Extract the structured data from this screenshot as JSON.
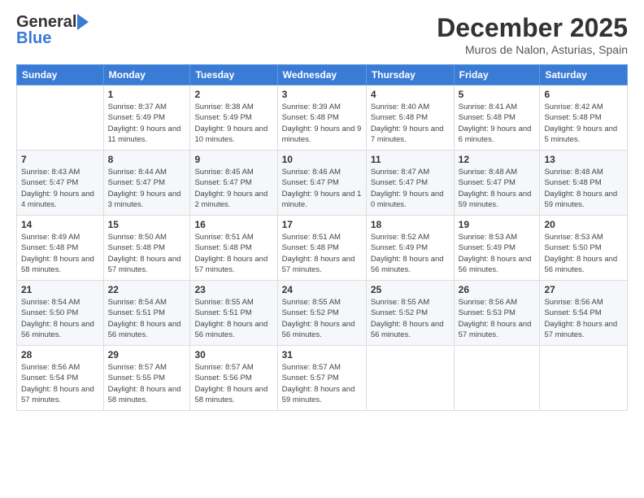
{
  "header": {
    "logo_general": "General",
    "logo_blue": "Blue",
    "title": "December 2025",
    "location": "Muros de Nalon, Asturias, Spain"
  },
  "days_of_week": [
    "Sunday",
    "Monday",
    "Tuesday",
    "Wednesday",
    "Thursday",
    "Friday",
    "Saturday"
  ],
  "weeks": [
    [
      {
        "day": "",
        "sunrise": "",
        "sunset": "",
        "daylight": ""
      },
      {
        "day": "1",
        "sunrise": "Sunrise: 8:37 AM",
        "sunset": "Sunset: 5:49 PM",
        "daylight": "Daylight: 9 hours and 11 minutes."
      },
      {
        "day": "2",
        "sunrise": "Sunrise: 8:38 AM",
        "sunset": "Sunset: 5:49 PM",
        "daylight": "Daylight: 9 hours and 10 minutes."
      },
      {
        "day": "3",
        "sunrise": "Sunrise: 8:39 AM",
        "sunset": "Sunset: 5:48 PM",
        "daylight": "Daylight: 9 hours and 9 minutes."
      },
      {
        "day": "4",
        "sunrise": "Sunrise: 8:40 AM",
        "sunset": "Sunset: 5:48 PM",
        "daylight": "Daylight: 9 hours and 7 minutes."
      },
      {
        "day": "5",
        "sunrise": "Sunrise: 8:41 AM",
        "sunset": "Sunset: 5:48 PM",
        "daylight": "Daylight: 9 hours and 6 minutes."
      },
      {
        "day": "6",
        "sunrise": "Sunrise: 8:42 AM",
        "sunset": "Sunset: 5:48 PM",
        "daylight": "Daylight: 9 hours and 5 minutes."
      }
    ],
    [
      {
        "day": "7",
        "sunrise": "Sunrise: 8:43 AM",
        "sunset": "Sunset: 5:47 PM",
        "daylight": "Daylight: 9 hours and 4 minutes."
      },
      {
        "day": "8",
        "sunrise": "Sunrise: 8:44 AM",
        "sunset": "Sunset: 5:47 PM",
        "daylight": "Daylight: 9 hours and 3 minutes."
      },
      {
        "day": "9",
        "sunrise": "Sunrise: 8:45 AM",
        "sunset": "Sunset: 5:47 PM",
        "daylight": "Daylight: 9 hours and 2 minutes."
      },
      {
        "day": "10",
        "sunrise": "Sunrise: 8:46 AM",
        "sunset": "Sunset: 5:47 PM",
        "daylight": "Daylight: 9 hours and 1 minute."
      },
      {
        "day": "11",
        "sunrise": "Sunrise: 8:47 AM",
        "sunset": "Sunset: 5:47 PM",
        "daylight": "Daylight: 9 hours and 0 minutes."
      },
      {
        "day": "12",
        "sunrise": "Sunrise: 8:48 AM",
        "sunset": "Sunset: 5:47 PM",
        "daylight": "Daylight: 8 hours and 59 minutes."
      },
      {
        "day": "13",
        "sunrise": "Sunrise: 8:48 AM",
        "sunset": "Sunset: 5:48 PM",
        "daylight": "Daylight: 8 hours and 59 minutes."
      }
    ],
    [
      {
        "day": "14",
        "sunrise": "Sunrise: 8:49 AM",
        "sunset": "Sunset: 5:48 PM",
        "daylight": "Daylight: 8 hours and 58 minutes."
      },
      {
        "day": "15",
        "sunrise": "Sunrise: 8:50 AM",
        "sunset": "Sunset: 5:48 PM",
        "daylight": "Daylight: 8 hours and 57 minutes."
      },
      {
        "day": "16",
        "sunrise": "Sunrise: 8:51 AM",
        "sunset": "Sunset: 5:48 PM",
        "daylight": "Daylight: 8 hours and 57 minutes."
      },
      {
        "day": "17",
        "sunrise": "Sunrise: 8:51 AM",
        "sunset": "Sunset: 5:48 PM",
        "daylight": "Daylight: 8 hours and 57 minutes."
      },
      {
        "day": "18",
        "sunrise": "Sunrise: 8:52 AM",
        "sunset": "Sunset: 5:49 PM",
        "daylight": "Daylight: 8 hours and 56 minutes."
      },
      {
        "day": "19",
        "sunrise": "Sunrise: 8:53 AM",
        "sunset": "Sunset: 5:49 PM",
        "daylight": "Daylight: 8 hours and 56 minutes."
      },
      {
        "day": "20",
        "sunrise": "Sunrise: 8:53 AM",
        "sunset": "Sunset: 5:50 PM",
        "daylight": "Daylight: 8 hours and 56 minutes."
      }
    ],
    [
      {
        "day": "21",
        "sunrise": "Sunrise: 8:54 AM",
        "sunset": "Sunset: 5:50 PM",
        "daylight": "Daylight: 8 hours and 56 minutes."
      },
      {
        "day": "22",
        "sunrise": "Sunrise: 8:54 AM",
        "sunset": "Sunset: 5:51 PM",
        "daylight": "Daylight: 8 hours and 56 minutes."
      },
      {
        "day": "23",
        "sunrise": "Sunrise: 8:55 AM",
        "sunset": "Sunset: 5:51 PM",
        "daylight": "Daylight: 8 hours and 56 minutes."
      },
      {
        "day": "24",
        "sunrise": "Sunrise: 8:55 AM",
        "sunset": "Sunset: 5:52 PM",
        "daylight": "Daylight: 8 hours and 56 minutes."
      },
      {
        "day": "25",
        "sunrise": "Sunrise: 8:55 AM",
        "sunset": "Sunset: 5:52 PM",
        "daylight": "Daylight: 8 hours and 56 minutes."
      },
      {
        "day": "26",
        "sunrise": "Sunrise: 8:56 AM",
        "sunset": "Sunset: 5:53 PM",
        "daylight": "Daylight: 8 hours and 57 minutes."
      },
      {
        "day": "27",
        "sunrise": "Sunrise: 8:56 AM",
        "sunset": "Sunset: 5:54 PM",
        "daylight": "Daylight: 8 hours and 57 minutes."
      }
    ],
    [
      {
        "day": "28",
        "sunrise": "Sunrise: 8:56 AM",
        "sunset": "Sunset: 5:54 PM",
        "daylight": "Daylight: 8 hours and 57 minutes."
      },
      {
        "day": "29",
        "sunrise": "Sunrise: 8:57 AM",
        "sunset": "Sunset: 5:55 PM",
        "daylight": "Daylight: 8 hours and 58 minutes."
      },
      {
        "day": "30",
        "sunrise": "Sunrise: 8:57 AM",
        "sunset": "Sunset: 5:56 PM",
        "daylight": "Daylight: 8 hours and 58 minutes."
      },
      {
        "day": "31",
        "sunrise": "Sunrise: 8:57 AM",
        "sunset": "Sunset: 5:57 PM",
        "daylight": "Daylight: 8 hours and 59 minutes."
      },
      {
        "day": "",
        "sunrise": "",
        "sunset": "",
        "daylight": ""
      },
      {
        "day": "",
        "sunrise": "",
        "sunset": "",
        "daylight": ""
      },
      {
        "day": "",
        "sunrise": "",
        "sunset": "",
        "daylight": ""
      }
    ]
  ]
}
